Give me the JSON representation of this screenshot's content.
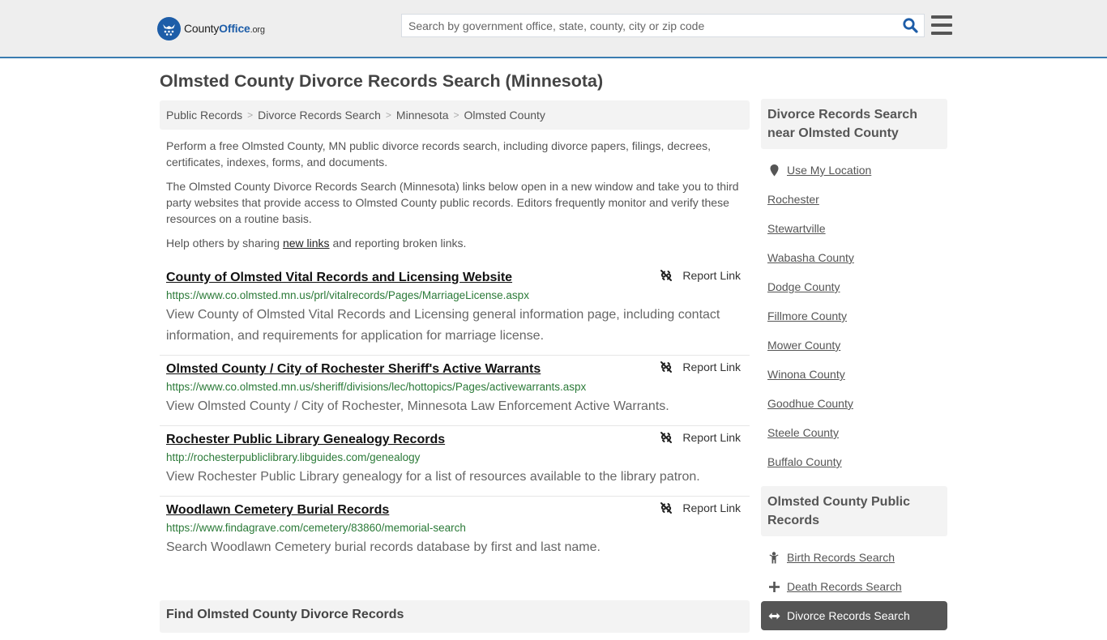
{
  "header": {
    "logo": {
      "name_part1": "County",
      "name_part2": "Office",
      "tld": ".org"
    },
    "search": {
      "placeholder": "Search by government office, state, county, city or zip code",
      "value": ""
    },
    "icons": {
      "search": "search-icon",
      "menu": "hamburger-menu-icon",
      "logo": "eagle-stars-badge-icon"
    }
  },
  "page": {
    "title": "Olmsted County Divorce Records Search (Minnesota)"
  },
  "breadcrumb": [
    {
      "label": "Public Records"
    },
    {
      "label": "Divorce Records Search"
    },
    {
      "label": "Minnesota"
    },
    {
      "label": "Olmsted County"
    }
  ],
  "breadcrumb_separator": ">",
  "intro": {
    "p1": "Perform a free Olmsted County, MN public divorce records search, including divorce papers, filings, decrees, certificates, indexes, forms, and documents.",
    "p2": "The Olmsted County Divorce Records Search (Minnesota) links below open in a new window and take you to third party websites that provide access to Olmsted County public records. Editors frequently monitor and verify these resources on a routine basis.",
    "p3_before": "Help others by sharing ",
    "p3_link": "new links",
    "p3_after": " and reporting broken links."
  },
  "results": [
    {
      "title": "County of Olmsted Vital Records and Licensing Website",
      "url": "https://www.co.olmsted.mn.us/prl/vitalrecords/Pages/MarriageLicense.aspx",
      "description": "View County of Olmsted Vital Records and Licensing general information page, including contact information, and requirements for application for marriage license.",
      "report_label": "Report Link"
    },
    {
      "title": "Olmsted County / City of Rochester Sheriff's Active Warrants",
      "url": "https://www.co.olmsted.mn.us/sheriff/divisions/lec/hottopics/Pages/activewarrants.aspx",
      "description": "View Olmsted County / City of Rochester, Minnesota Law Enforcement Active Warrants.",
      "report_label": "Report Link"
    },
    {
      "title": "Rochester Public Library Genealogy Records",
      "url": "http://rochesterpubliclibrary.libguides.com/genealogy",
      "description": "View Rochester Public Library genealogy for a list of resources available to the library patron.",
      "report_label": "Report Link"
    },
    {
      "title": "Woodlawn Cemetery Burial Records",
      "url": "https://www.findagrave.com/cemetery/83860/memorial-search",
      "description": "Search Woodlawn Cemetery burial records database by first and last name.",
      "report_label": "Report Link"
    }
  ],
  "find_box": {
    "title": "Find Olmsted County Divorce Records"
  },
  "sidebar": {
    "nearby": {
      "title": "Divorce Records Search near Olmsted County",
      "use_location": "Use My Location",
      "items": [
        "Rochester",
        "Stewartville",
        "Wabasha County",
        "Dodge County",
        "Fillmore County",
        "Mower County",
        "Winona County",
        "Goodhue County",
        "Steele County",
        "Buffalo County"
      ]
    },
    "public_records": {
      "title": "Olmsted County Public Records",
      "items": [
        {
          "label": "Birth Records Search",
          "icon": "child-icon",
          "active": false
        },
        {
          "label": "Death Records Search",
          "icon": "cross-icon",
          "active": false
        },
        {
          "label": "Divorce Records Search",
          "icon": "arrows-horizontal-icon",
          "active": true
        }
      ]
    }
  },
  "colors": {
    "brand_blue": "#1d5da8",
    "header_border": "#3a7cb0",
    "url_green": "#2b7a38",
    "active_item": "#555555"
  }
}
